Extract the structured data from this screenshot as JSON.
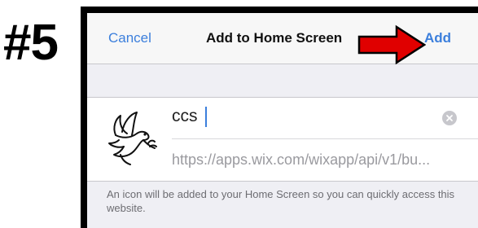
{
  "step_label": "#5",
  "navbar": {
    "cancel_label": "Cancel",
    "title": "Add to Home Screen",
    "add_label": "Add"
  },
  "form": {
    "name_value": "ccs",
    "url": "https://apps.wix.com/wixapp/api/v1/bu..."
  },
  "footer": {
    "text": "An icon will be added to your Home Screen so you can quickly access this website."
  },
  "colors": {
    "ios_blue": "#3c7fdc",
    "arrow_red": "#e00000",
    "background": "#efeff4"
  },
  "icons": {
    "annotation": "red-arrow-icon",
    "clear": "clear-icon",
    "app": "dove-icon"
  }
}
